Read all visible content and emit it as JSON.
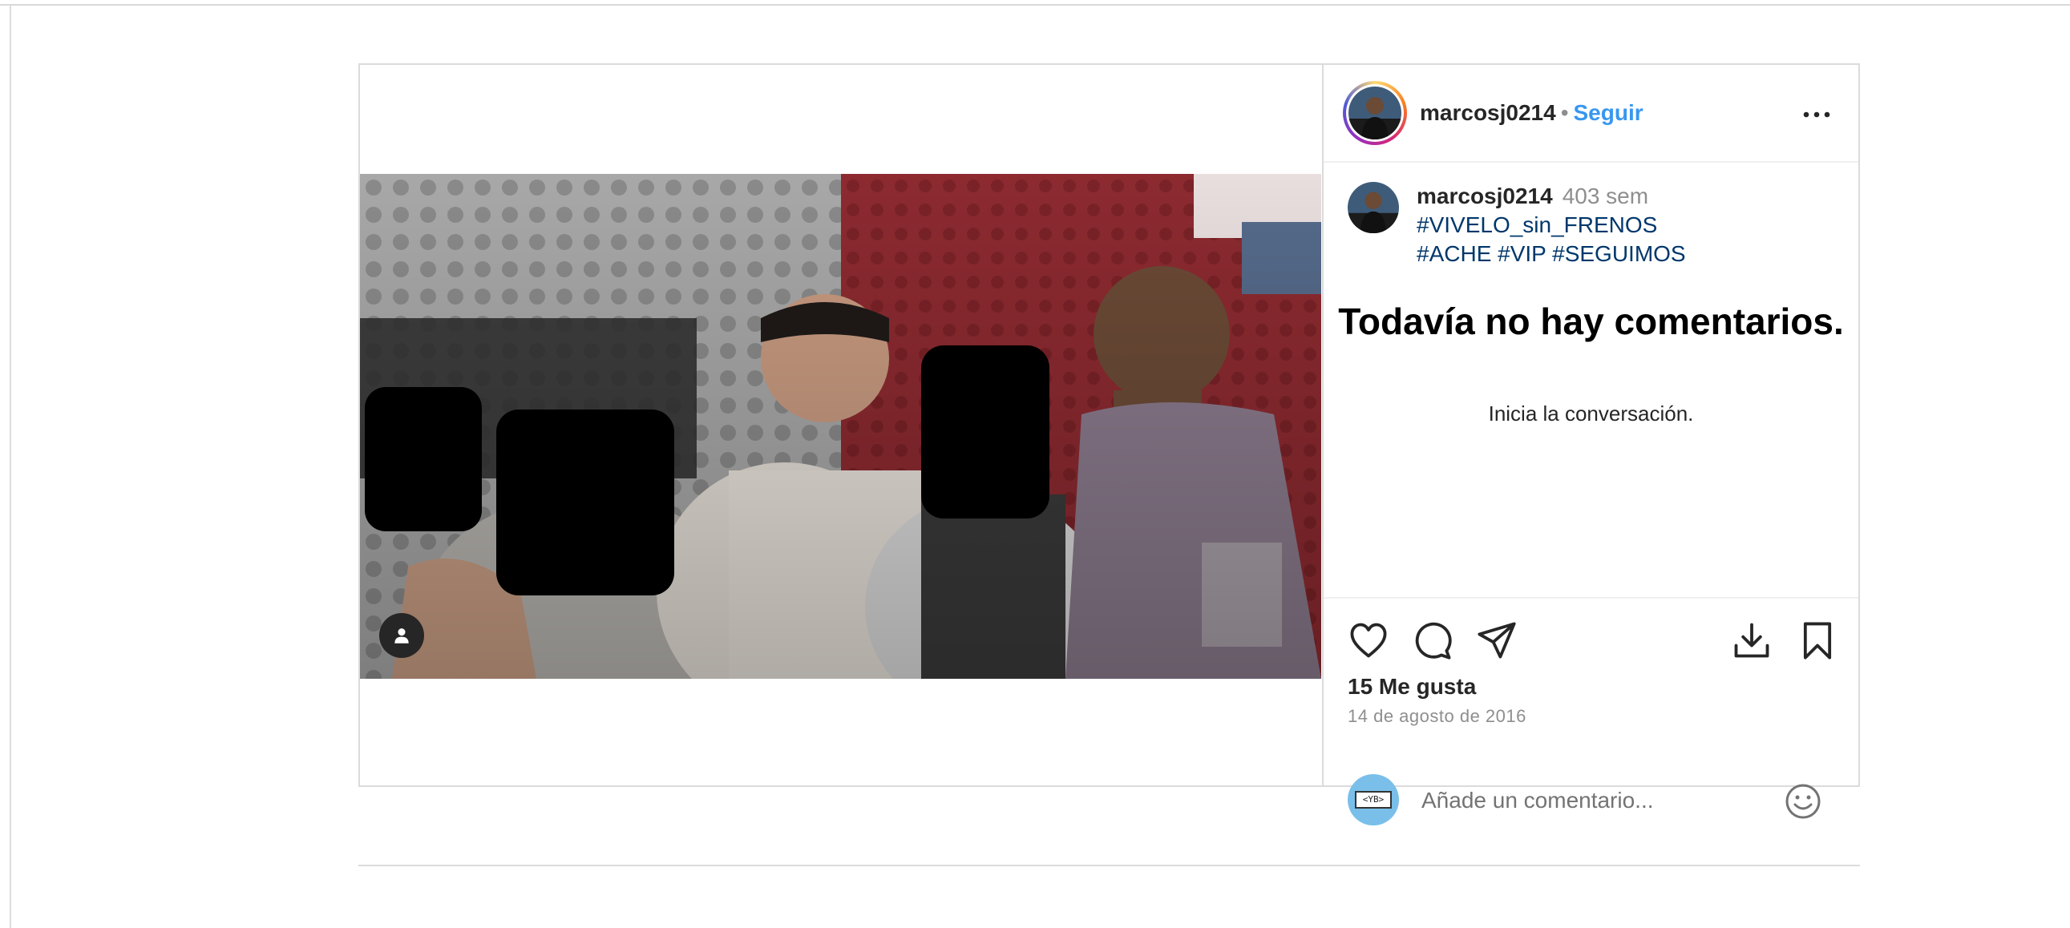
{
  "post": {
    "username": "marcosj0214",
    "separator": "•",
    "follow_label": "Seguir",
    "more_icon": "more-options-icon",
    "caption": {
      "username": "marcosj0214",
      "time_ago": "403 sem",
      "hashtags_line1": "#VIVELO_sin_FRENOS",
      "hashtags_line2": "#ACHE #VIP #SEGUIMOS"
    },
    "empty_comments_title": "Todavía no hay comentarios.",
    "empty_comments_subtitle": "Inicia la conversación.",
    "likes": "15 Me gusta",
    "date": "14 de agosto de 2016",
    "comment_placeholder": "Añade un comentario...",
    "viewer_avatar_text": "<YB>",
    "tagged_icon": "user-tag-icon"
  },
  "colors": {
    "link": "#3897f0",
    "hashtag": "#00376b",
    "muted": "#8e8e8e",
    "border": "#dbdbdb"
  }
}
